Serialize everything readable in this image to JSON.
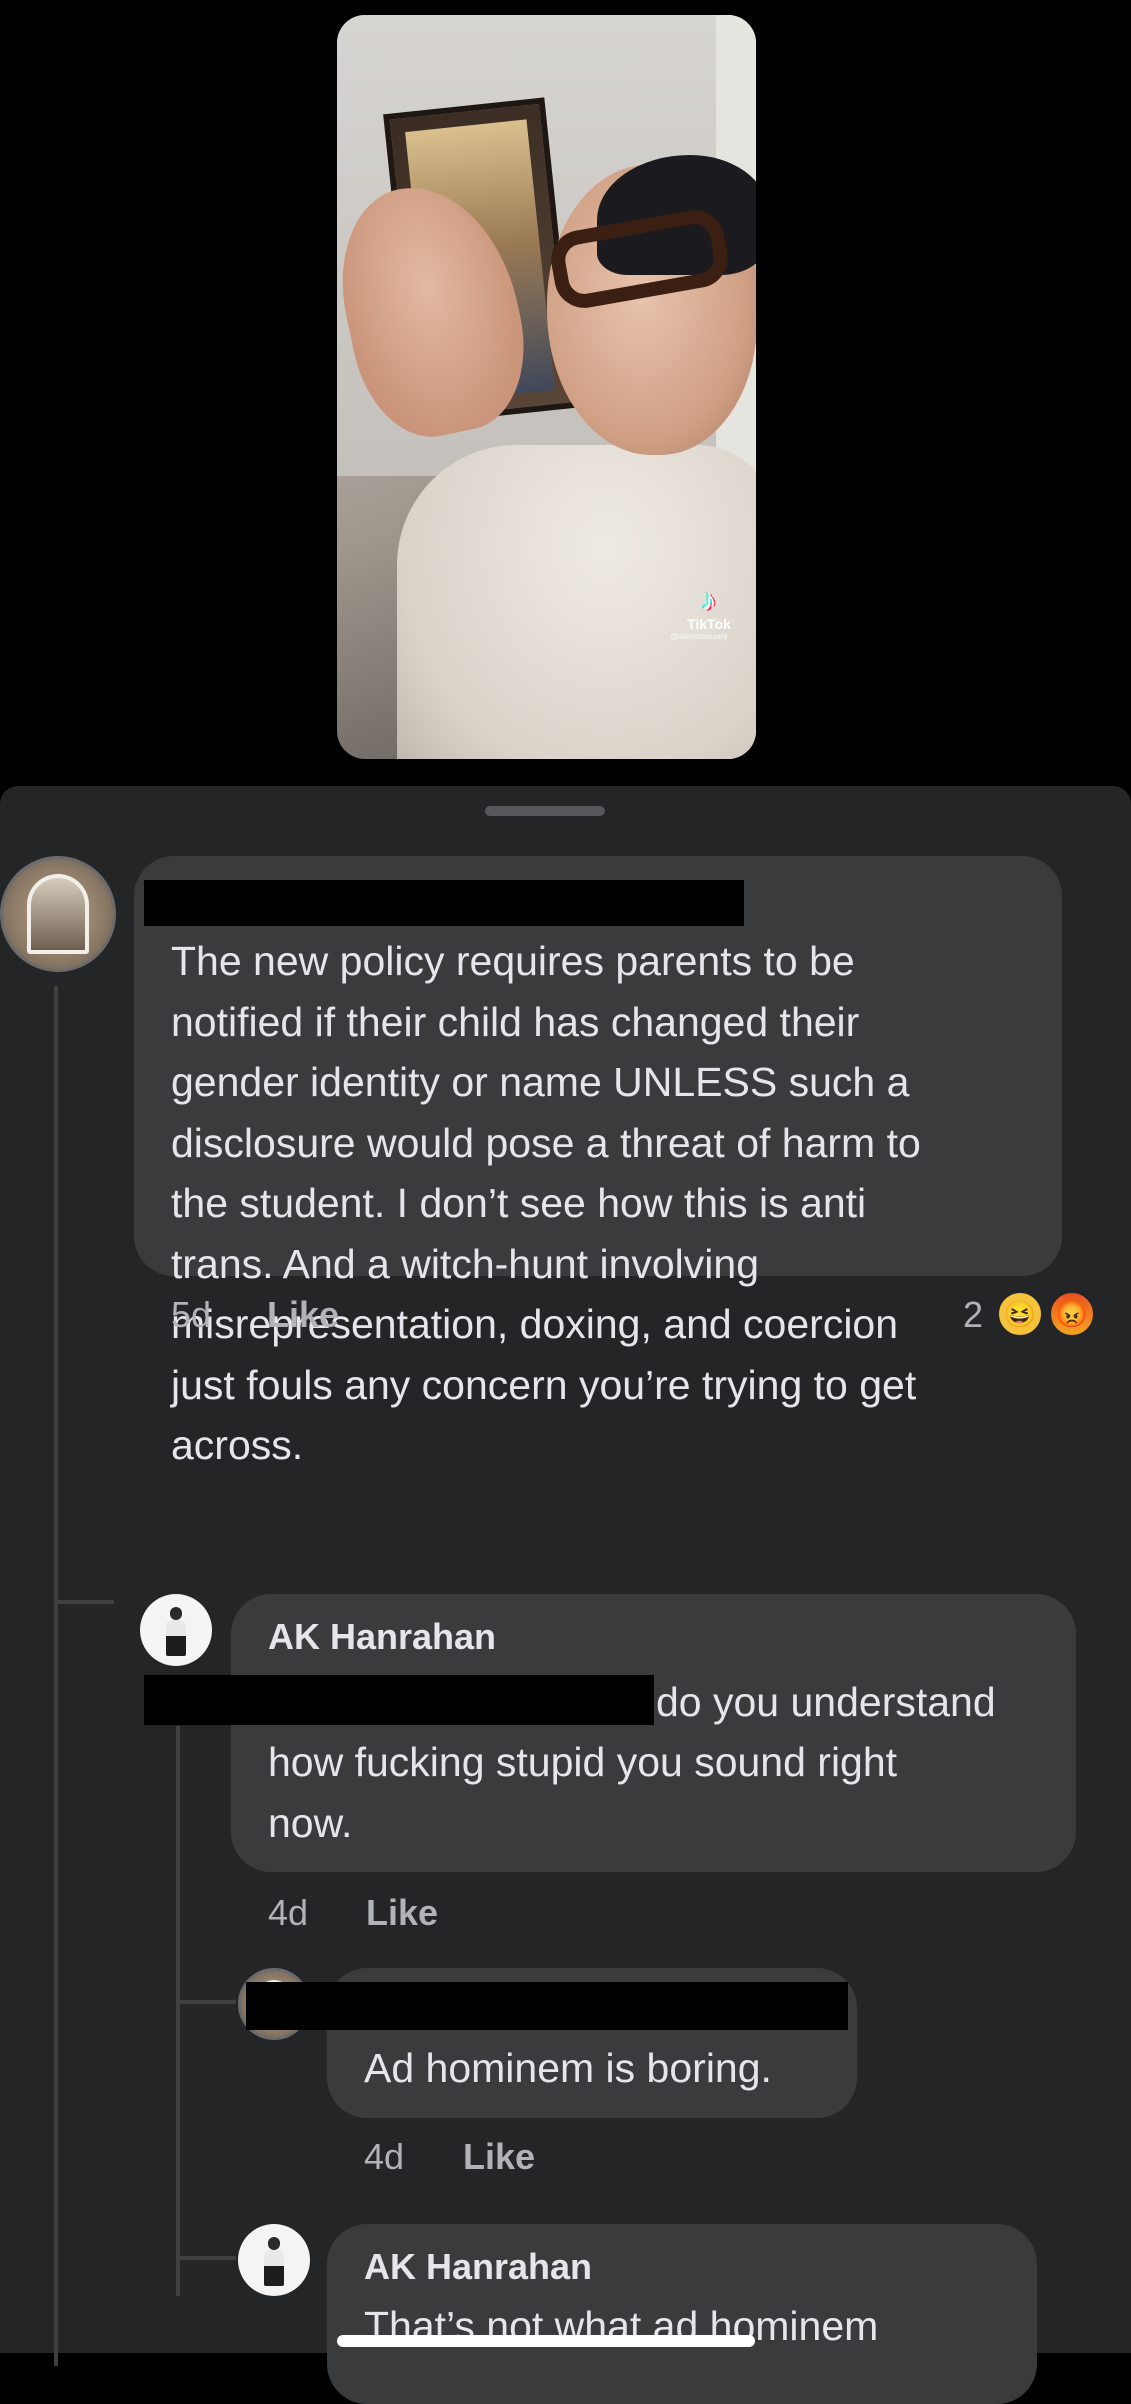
{
  "video": {
    "watermark_brand": "TikTok",
    "watermark_handle": "@akneccessary",
    "icon": "tiktok-logo-icon"
  },
  "comments": [
    {
      "author_redacted": true,
      "text": "The new policy requires parents to be\nnotified if their child has changed their\ngender identity or name UNLESS such a\ndisclosure would pose a threat of harm to\nthe student. I don’t see how this is anti\ntrans. And a witch-hunt involving\nmisrepresentation, doxing, and coercion\njust fouls any concern you’re trying to get\nacross.",
      "time": "5d",
      "like_label": "Like",
      "reaction_count": "2",
      "reactions": [
        "haha-reaction-icon",
        "angry-reaction-icon"
      ]
    },
    {
      "author": "AK Hanrahan",
      "text_first_line": "do you understand",
      "text_rest": "how fucking stupid you sound right\nnow.",
      "time": "4d",
      "like_label": "Like"
    },
    {
      "author_redacted": true,
      "text": "Ad hominem is boring.",
      "time": "4d",
      "like_label": "Like"
    },
    {
      "author": "AK Hanrahan",
      "text": "That’s not what ad hominem"
    }
  ],
  "colors": {
    "sheet_bg": "#242526",
    "bubble_bg": "#3a3b3c",
    "primary_text": "#e4e6eb",
    "secondary_text": "#b0b3b8"
  }
}
